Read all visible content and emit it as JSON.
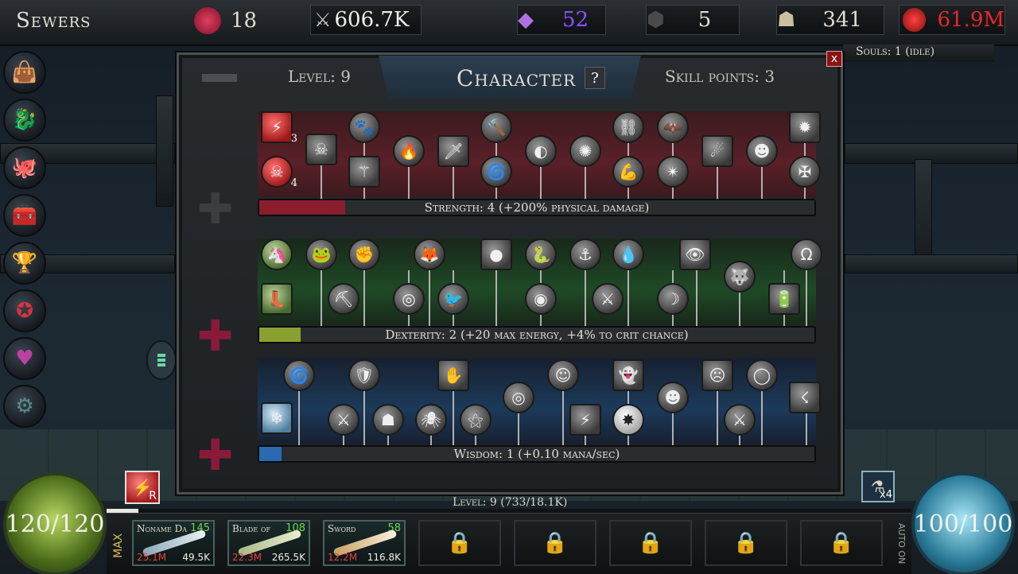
{
  "topbar": {
    "zone": "Sewers",
    "rose_count": "18",
    "attack": "606.7K",
    "crystals": "52",
    "stones": "5",
    "bones": "341",
    "gold": "61.9M"
  },
  "souls": "Souls: 1 (idle)",
  "sidebar": [
    {
      "icon": "bag-icon",
      "glyph": "👜"
    },
    {
      "icon": "gargoyle-icon",
      "glyph": "🐉"
    },
    {
      "icon": "octopus-icon",
      "glyph": "🐙"
    },
    {
      "icon": "chest-icon",
      "glyph": "🧰"
    },
    {
      "icon": "chalice-icon",
      "glyph": "🏆"
    },
    {
      "icon": "pentagram-icon",
      "glyph": "✪"
    },
    {
      "icon": "heart-shield-icon",
      "glyph": "♥"
    },
    {
      "icon": "gear-icon",
      "glyph": "⚙"
    }
  ],
  "panel": {
    "title": "Character",
    "help": "?",
    "close": "x",
    "level": "Level: 9",
    "skill_points": "Skill points: 3"
  },
  "rows": {
    "strength": {
      "label": "Strength: 4   (+200% physical damage)",
      "fill": 0.155,
      "color": "#8a1e2c",
      "plus_color": "#3a3e40"
    },
    "dexterity": {
      "label": "Dexterity: 2   (+20 max energy, +4% to crit chance)",
      "fill": 0.075,
      "color": "#8aa030",
      "plus_color": "#8a1a3a"
    },
    "wisdom": {
      "label": "Wisdom: 1   (+0.10 mana/sec)",
      "fill": 0.04,
      "color": "#2a6ab0",
      "plus_color": "#8a1a3a"
    }
  },
  "skill_badges": {
    "str_top": "3",
    "str_bottom": "4"
  },
  "hp": "120/120",
  "mp": "100/100",
  "bottom": {
    "level_line": "Level: 9  (733/18.1K)",
    "xp_fill": 0.04,
    "max_label": "MAX",
    "auto_label": "AUTO ON",
    "ability_key": "R",
    "potion_count": "x4"
  },
  "weapons": [
    {
      "name": "Noname Da",
      "level": "145",
      "red": "25.1M",
      "white": "49.5K"
    },
    {
      "name": "Blade of",
      "level": "108",
      "red": "22.3M",
      "white": "265.5K"
    },
    {
      "name": "Sword",
      "level": "58",
      "red": "12.2M",
      "white": "116.8K"
    }
  ],
  "locked_slots": [
    "🔒",
    "🔒",
    "🔒",
    "🔒",
    "🔒"
  ]
}
